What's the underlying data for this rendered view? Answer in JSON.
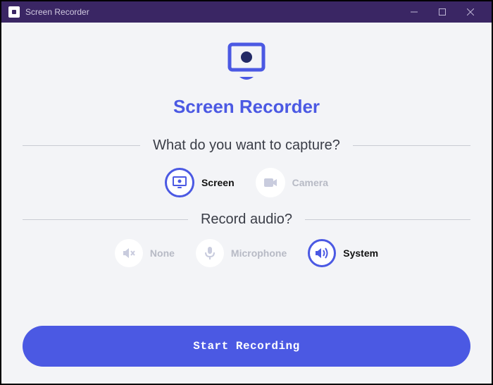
{
  "titlebar": {
    "title": "Screen Recorder"
  },
  "app": {
    "title": "Screen Recorder"
  },
  "capture": {
    "question": "What do you want to capture?",
    "options": {
      "screen": "Screen",
      "camera": "Camera"
    },
    "selected": "screen"
  },
  "audio": {
    "question": "Record audio?",
    "options": {
      "none": "None",
      "microphone": "Microphone",
      "system": "System"
    },
    "selected": "system"
  },
  "actions": {
    "start": "Start Recording"
  },
  "colors": {
    "accent": "#4b59e3",
    "titlebar": "#3a2664"
  }
}
